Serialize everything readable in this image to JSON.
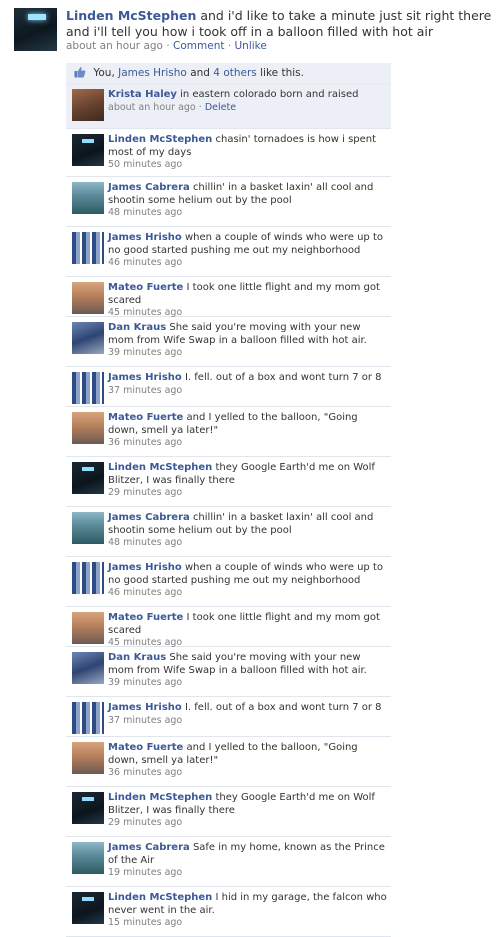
{
  "post": {
    "author": "Linden McStephen",
    "text": "and i'd like to take a minute just sit right there and i'll tell you how i took off in a balloon filled with hot air",
    "time": "about an hour ago",
    "separator": "·",
    "comment_label": "Comment",
    "unlike_label": "Unlike"
  },
  "likes": {
    "you": "You,",
    "person": "James Hrisho",
    "and": "and",
    "others": "4 others",
    "suffix": "like this."
  },
  "comments": [
    {
      "name": "Krista Haley",
      "text": "in eastern colorado born and raised",
      "time": "about an hour ago",
      "delete_label": "Delete",
      "avatar": "krista"
    },
    {
      "name": "Linden McStephen",
      "text": "chasin' tornadoes is how i spent most of my days",
      "time": "50 minutes ago",
      "avatar": "linden"
    },
    {
      "name": "James Cabrera",
      "text": "chillin' in a basket laxin' all cool and shootin some helium out by the pool",
      "time": "48 minutes ago",
      "avatar": "james-c"
    },
    {
      "name": "James Hrisho",
      "text": "when a couple of winds who were up to no good started pushing me out my neighborhood",
      "time": "46 minutes ago",
      "avatar": "james-h"
    },
    {
      "name": "Mateo Fuerte",
      "text": "I took one little flight and my mom got scared",
      "time": "45 minutes ago",
      "avatar": "mateo"
    },
    {
      "name": "Dan Kraus",
      "text": "She said you're moving with your new mom from Wife Swap in a balloon filled with hot air.",
      "time": "39 minutes ago",
      "avatar": "dan"
    },
    {
      "name": "James Hrisho",
      "text": "I. fell. out of a box and wont turn 7 or 8",
      "time": "37 minutes ago",
      "avatar": "james-h"
    },
    {
      "name": "Mateo Fuerte",
      "text": "and I yelled to the balloon, \"Going down, smell ya later!\"",
      "time": "36 minutes ago",
      "avatar": "mateo"
    },
    {
      "name": "Linden McStephen",
      "text": "they Google Earth'd me on Wolf Blitzer, I was finally there",
      "time": "29 minutes ago",
      "avatar": "linden"
    },
    {
      "name": "James Cabrera",
      "text": "chillin' in a basket laxin' all cool and shootin some helium out by the pool",
      "time": "48 minutes ago",
      "avatar": "james-c"
    },
    {
      "name": "James Hrisho",
      "text": "when a couple of winds who were up to no good started pushing me out my neighborhood",
      "time": "46 minutes ago",
      "avatar": "james-h"
    },
    {
      "name": "Mateo Fuerte",
      "text": "I took one little flight and my mom got scared",
      "time": "45 minutes ago",
      "avatar": "mateo"
    },
    {
      "name": "Dan Kraus",
      "text": "She said you're moving with your new mom from Wife Swap in a balloon filled with hot air.",
      "time": "39 minutes ago",
      "avatar": "dan"
    },
    {
      "name": "James Hrisho",
      "text": "I. fell. out of a box and wont turn 7 or 8",
      "time": "37 minutes ago",
      "avatar": "james-h"
    },
    {
      "name": "Mateo Fuerte",
      "text": "and I yelled to the balloon, \"Going down, smell ya later!\"",
      "time": "36 minutes ago",
      "avatar": "mateo"
    },
    {
      "name": "Linden McStephen",
      "text": "they Google Earth'd me on Wolf Blitzer, I was finally there",
      "time": "29 minutes ago",
      "avatar": "linden"
    },
    {
      "name": "James Cabrera",
      "text": "Safe in my home, known as the Prince of the Air",
      "time": "19 minutes ago",
      "avatar": "james-c"
    },
    {
      "name": "Linden McStephen",
      "text": "I hid in my garage, the falcon who never went in the air.",
      "time": "15 minutes ago",
      "avatar": "linden"
    }
  ],
  "colors": {
    "link": "#3b5998",
    "meta": "#808080",
    "like_bar": "#eceff5"
  }
}
